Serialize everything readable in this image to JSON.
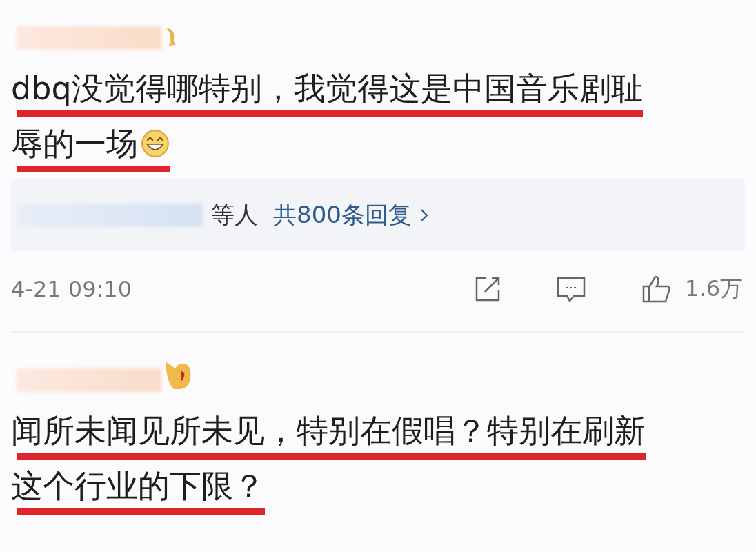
{
  "comments": [
    {
      "lines": [
        {
          "text": "dbq没觉得哪特别，我觉得这是中国音乐剧耻",
          "emoji": false
        },
        {
          "text": "辱的一场",
          "emoji": true
        }
      ],
      "reply_summary": {
        "suffix": "等人",
        "link": "共800条回复"
      },
      "footer": {
        "time": "4-21 09:10",
        "likes": "1.6万"
      }
    },
    {
      "lines": [
        {
          "text": "闻所未闻见所未见，特别在假唱？特别在刷新",
          "emoji": false
        },
        {
          "text": "这个行业的下限？",
          "emoji": false
        }
      ]
    }
  ]
}
